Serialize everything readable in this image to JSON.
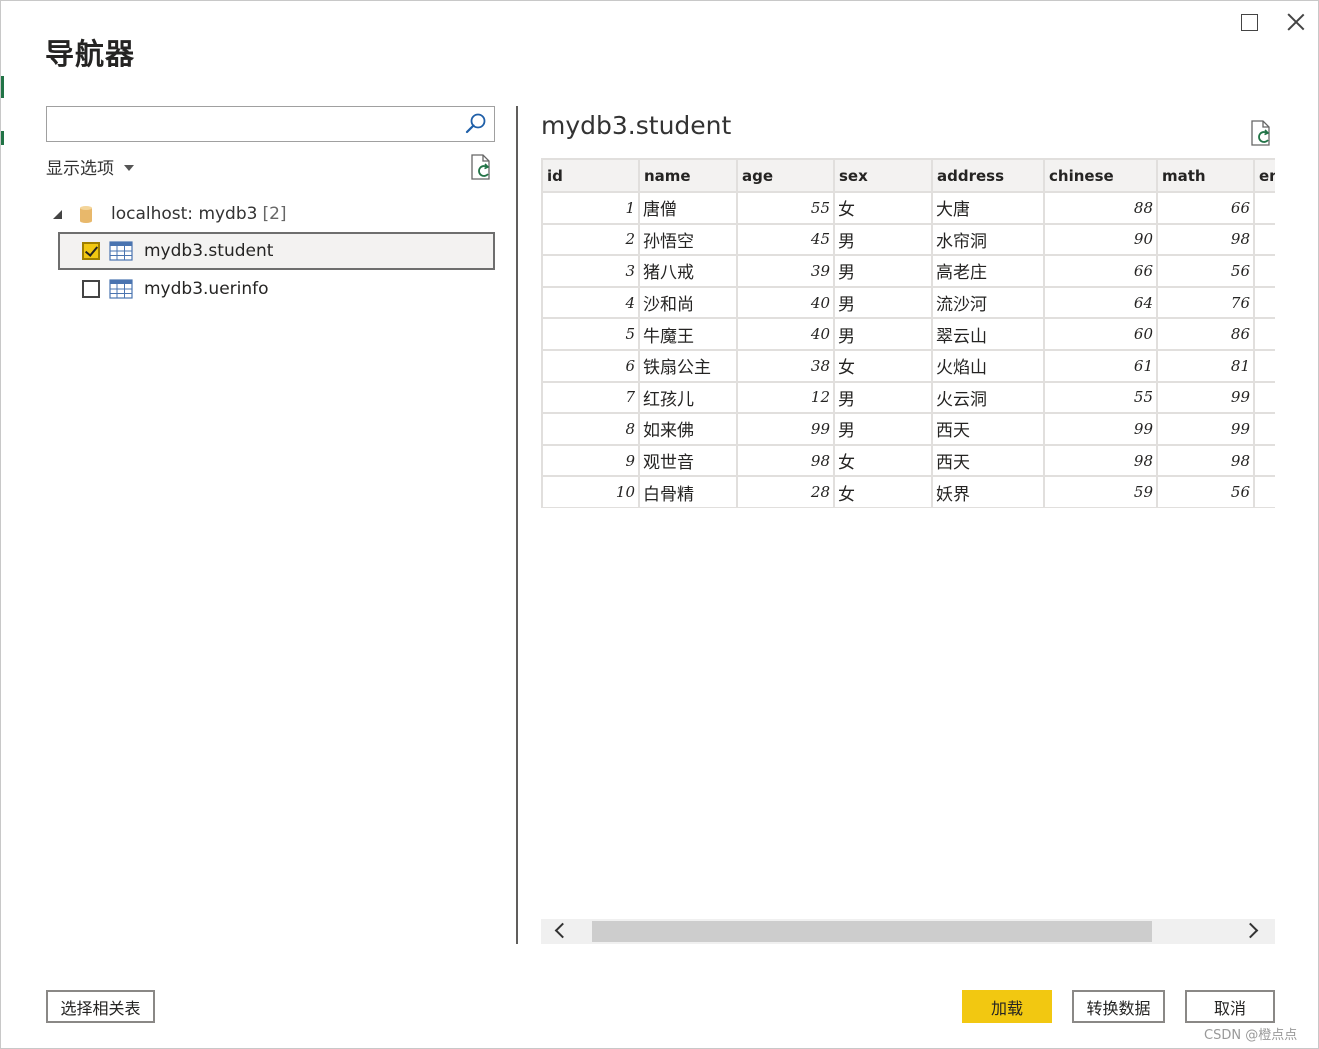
{
  "window": {
    "title": "导航器"
  },
  "search": {
    "value": "",
    "placeholder": ""
  },
  "display_options_label": "显示选项",
  "tree": {
    "root_label": "localhost: mydb3",
    "root_count": "[2]",
    "items": [
      {
        "label": "mydb3.student",
        "checked": true,
        "selected": true
      },
      {
        "label": "mydb3.uerinfo",
        "checked": false,
        "selected": false
      }
    ]
  },
  "preview": {
    "title": "mydb3.student",
    "columns": [
      "id",
      "name",
      "age",
      "sex",
      "address",
      "chinese",
      "math",
      "en"
    ],
    "rows": [
      [
        "1",
        "唐僧",
        "55",
        "女",
        "大唐",
        "88",
        "66",
        ""
      ],
      [
        "2",
        "孙悟空",
        "45",
        "男",
        "水帘洞",
        "90",
        "98",
        ""
      ],
      [
        "3",
        "猪八戒",
        "39",
        "男",
        "高老庄",
        "66",
        "56",
        ""
      ],
      [
        "4",
        "沙和尚",
        "40",
        "男",
        "流沙河",
        "64",
        "76",
        ""
      ],
      [
        "5",
        "牛魔王",
        "40",
        "男",
        "翠云山",
        "60",
        "86",
        ""
      ],
      [
        "6",
        "铁扇公主",
        "38",
        "女",
        "火焰山",
        "61",
        "81",
        ""
      ],
      [
        "7",
        "红孩儿",
        "12",
        "男",
        "火云洞",
        "55",
        "99",
        ""
      ],
      [
        "8",
        "如来佛",
        "99",
        "男",
        "西天",
        "99",
        "99",
        ""
      ],
      [
        "9",
        "观世音",
        "98",
        "女",
        "西天",
        "98",
        "98",
        ""
      ],
      [
        "10",
        "白骨精",
        "28",
        "女",
        "妖界",
        "59",
        "56",
        ""
      ]
    ]
  },
  "buttons": {
    "select_related": "选择相关表",
    "load": "加载",
    "transform": "转换数据",
    "cancel": "取消"
  },
  "watermark": "CSDN @橙点点",
  "colors": {
    "accent_yellow": "#f2c811",
    "divider": "#605e5c",
    "grid_header_bg": "#f3f2f1",
    "grid_border": "#e1dfdd",
    "excel_green": "#217346"
  },
  "icons": [
    "search-icon",
    "caret-down-icon",
    "refresh-icon",
    "database-icon",
    "table-icon",
    "check-icon",
    "chevron-left-icon",
    "chevron-right-icon",
    "maximize-icon",
    "close-icon"
  ]
}
